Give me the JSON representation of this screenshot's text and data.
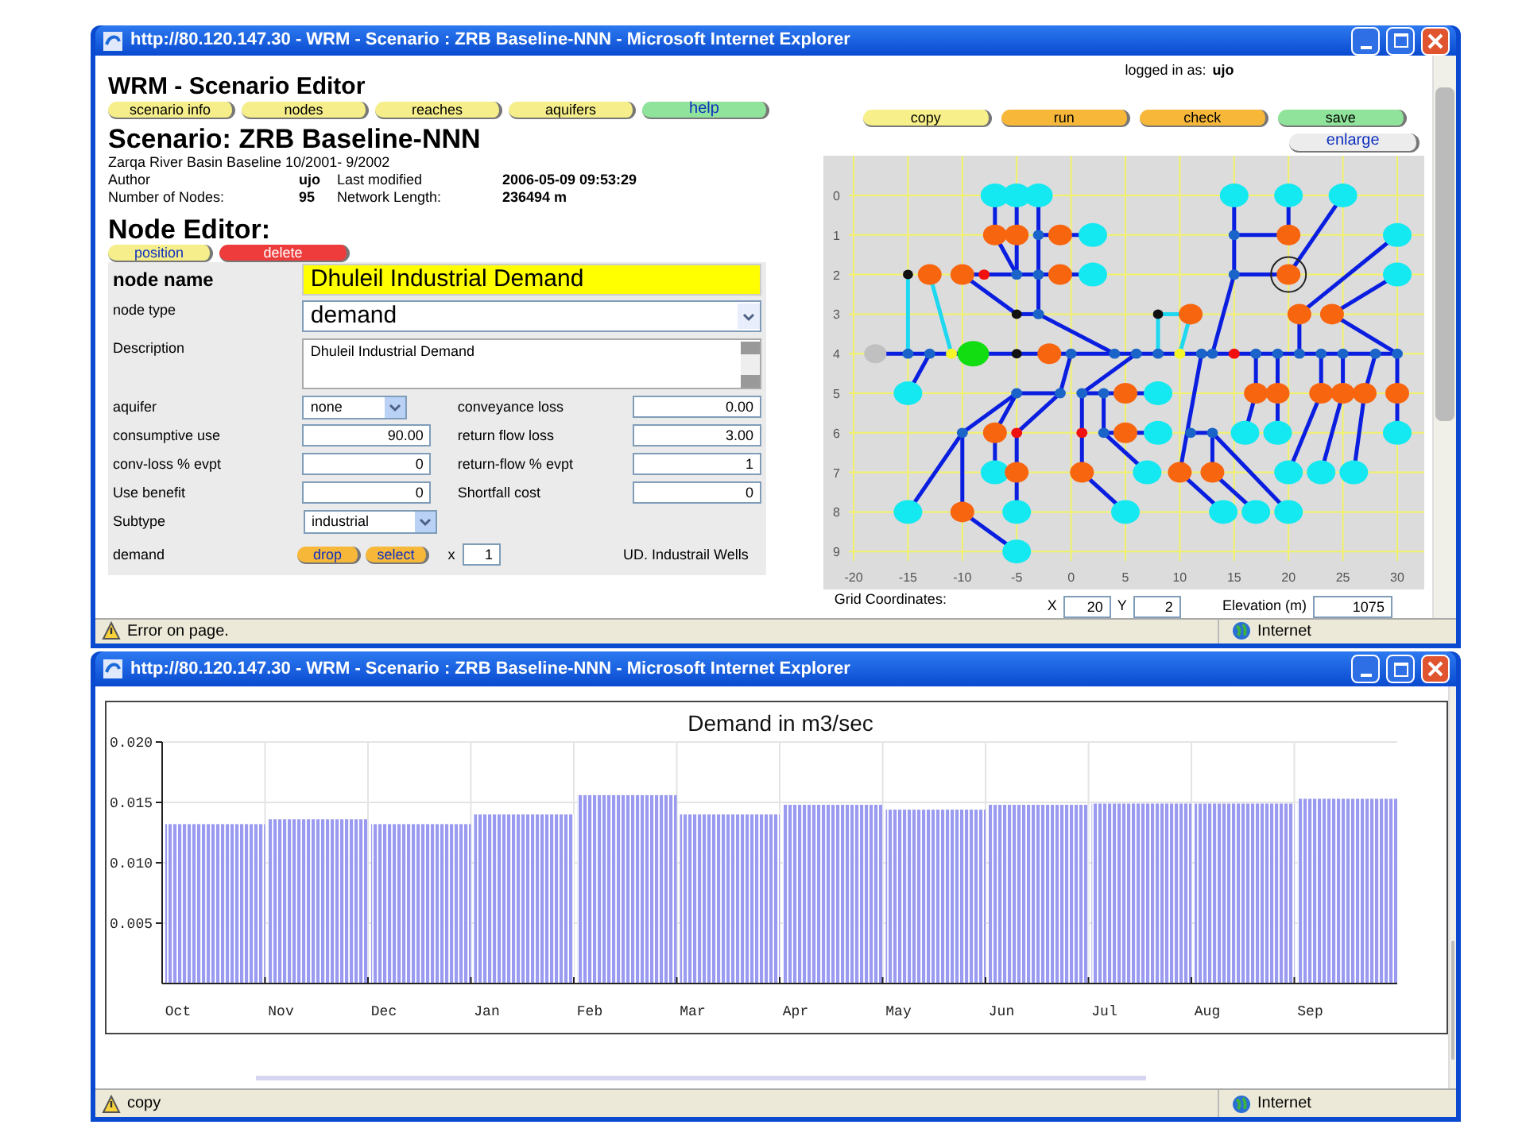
{
  "editor_window": {
    "title": "http://80.120.147.30 - WRM - Scenario : ZRB Baseline-NNN - Microsoft Internet Explorer",
    "app_title": "WRM - Scenario Editor",
    "nav_buttons": [
      {
        "label": "scenario info",
        "color": "#f5ee8a"
      },
      {
        "label": "nodes",
        "color": "#f5ee8a"
      },
      {
        "label": "reaches",
        "color": "#f5ee8a"
      },
      {
        "label": "aquifers",
        "color": "#f5ee8a"
      },
      {
        "label": "help",
        "color": "#8fe39a"
      }
    ],
    "logged_in_label": "logged in as:",
    "logged_in_user": "ujo",
    "action_buttons": [
      {
        "label": "copy",
        "color": "#f7f08a"
      },
      {
        "label": "run",
        "color": "#f7b83a"
      },
      {
        "label": "check",
        "color": "#f7b83a"
      },
      {
        "label": "save",
        "color": "#8fe39a"
      }
    ],
    "enlarge_button": "enlarge",
    "scenario_title": "Scenario: ZRB Baseline-NNN",
    "scenario_description": "Zarqa River Basin Baseline 10/2001- 9/2002",
    "info": [
      {
        "label": "Author",
        "value": "ujo",
        "label2": "Last modified",
        "value2": "2006-05-09 09:53:29"
      },
      {
        "label": "Number of Nodes:",
        "value": "95",
        "label2": "Network Length:",
        "value2": "236494 m"
      }
    ],
    "node_editor_title": "Node Editor:",
    "editor_buttons": [
      {
        "label": "position",
        "color": "#f5ee8a"
      },
      {
        "label": "delete",
        "color": "#ee3b3b"
      }
    ],
    "node_name": {
      "label": "node name",
      "value": "Dhuleil Industrial Demand"
    },
    "node_type": {
      "label": "node type",
      "value": "demand"
    },
    "description": {
      "label": "Description",
      "value": "Dhuleil Industrial Demand"
    },
    "rows": [
      {
        "label": "aquifer",
        "kind": "select",
        "value": "none",
        "label2": "conveyance loss",
        "value2": "0.00"
      },
      {
        "label": "consumptive use",
        "kind": "input",
        "value": "90.00",
        "label2": "return flow loss",
        "value2": "3.00"
      },
      {
        "label": "conv-loss % evpt",
        "kind": "input",
        "value": "0",
        "label2": "return-flow % evpt",
        "value2": "1"
      },
      {
        "label": "Use benefit",
        "kind": "input",
        "value": "0",
        "label2": "Shortfall cost",
        "value2": "0"
      },
      {
        "label": "Subtype",
        "kind": "select",
        "value": "industrial"
      }
    ],
    "demand": {
      "label": "demand",
      "buttons": [
        "drop",
        "select"
      ],
      "multiplier_label": "x",
      "multiplier": "1",
      "source": "UD. Industrail Wells"
    },
    "map": {
      "y_ticks": [
        "0",
        "1",
        "2",
        "3",
        "4",
        "5",
        "6",
        "7",
        "8",
        "9"
      ],
      "x_ticks": [
        "-20",
        "-15",
        "-10",
        "-5",
        "0",
        "5",
        "10",
        "15",
        "20",
        "25",
        "30"
      ],
      "grid_label": "Grid Coordinates:",
      "x_label": "X",
      "x_value": "20",
      "y_label": "Y",
      "y_value": "2",
      "elevation_label": "Elevation (m)",
      "elevation_value": "1075"
    },
    "status": "Error on page.",
    "zone": "Internet"
  },
  "chart_window": {
    "title": "http://80.120.147.30 - WRM - Scenario : ZRB Baseline-NNN - Microsoft Internet Explorer",
    "chart_data": {
      "type": "bar",
      "title": "Demand in m3/sec",
      "categories": [
        "Oct",
        "Nov",
        "Dec",
        "Jan",
        "Feb",
        "Mar",
        "Apr",
        "May",
        "Jun",
        "Jul",
        "Aug",
        "Sep"
      ],
      "grid": true,
      "series": [
        {
          "color": "#9a9af0",
          "values": [
            0.0132,
            0.0136,
            0.0132,
            0.014,
            0.0156,
            0.014,
            0.0148,
            0.0144,
            0.0148,
            0.0149,
            0.0149,
            0.0153
          ]
        }
      ],
      "ylim": [
        0,
        0.02
      ],
      "yticks": [
        {
          "value": 0.005,
          "label": "0.005"
        },
        {
          "value": 0.01,
          "label": "0.010"
        },
        {
          "value": 0.015,
          "label": "0.015"
        },
        {
          "value": 0.02,
          "label": "0.020"
        }
      ]
    },
    "status": "copy",
    "zone": "Internet"
  }
}
